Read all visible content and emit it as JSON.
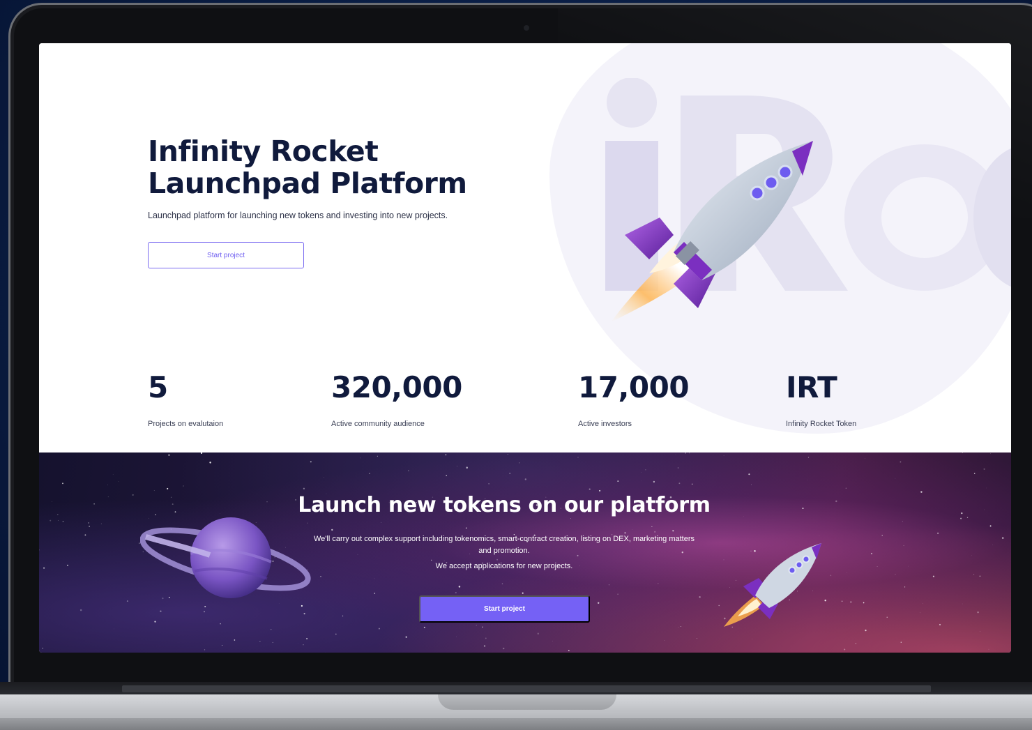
{
  "hero": {
    "title_line1": "Infinity Rocket",
    "title_line2": "Launchpad Platform",
    "subtitle": "Launchpad platform for launching new tokens and investing into new projects.",
    "cta_label": "Start project"
  },
  "stats": [
    {
      "value": "5",
      "label": "Projects on evalutaion"
    },
    {
      "value": "320,000",
      "label": "Active community audience"
    },
    {
      "value": "17,000",
      "label": "Active investors"
    },
    {
      "value": "IRT",
      "label": "Infinity Rocket Token"
    }
  ],
  "launch": {
    "title": "Launch new tokens on our platform",
    "description": "We'll carry out complex support including tokenomics, smart-contract creation, listing on DEX, marketing matters and promotion.",
    "note": "We accept applications for new projects.",
    "cta_label": "Start project"
  },
  "colors": {
    "accent": "#7561f5",
    "heading": "#101a3c",
    "rocket_purple": "#7b2fc0"
  }
}
